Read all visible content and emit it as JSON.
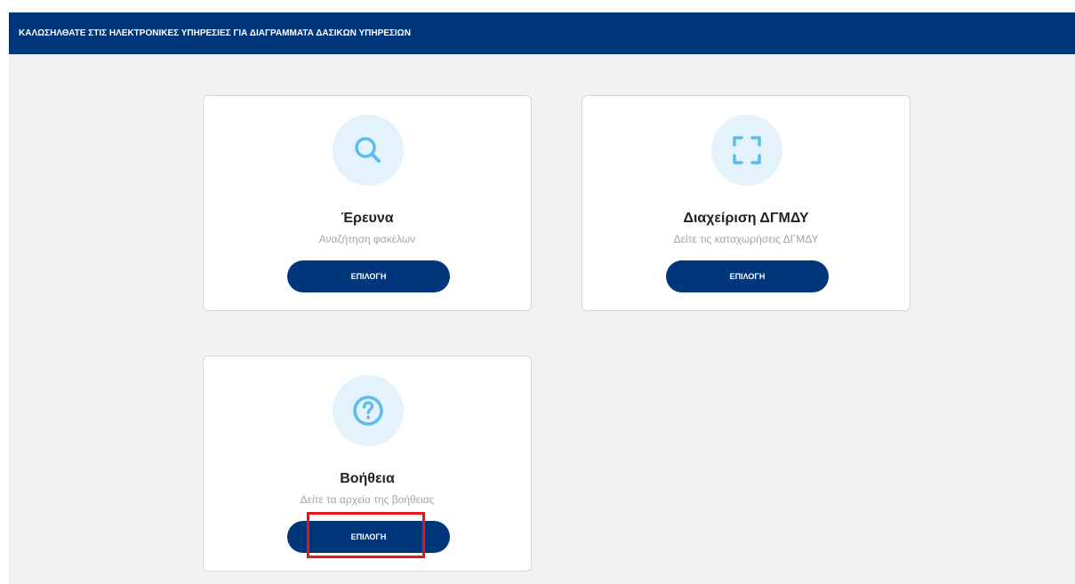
{
  "banner": {
    "title": "ΚΑΛΩΣΗΛΘΑΤΕ ΣΤΙΣ ΗΛΕΚΤΡΟΝΙΚΕΣ ΥΠΗΡΕΣΙΕΣ ΓΙΑ ΔΙΑΓΡΑΜΜΑΤΑ ΔΑΣΙΚΩΝ ΥΠΗΡΕΣΙΩΝ"
  },
  "cards": [
    {
      "icon": "search-icon",
      "title": "Έρευνα",
      "subtitle": "Αναζήτηση φακέλων",
      "button_label": "ΕΠΙΛΟΓΗ"
    },
    {
      "icon": "fullscreen-icon",
      "title": "Διαχείριση ΔΓΜΔΥ",
      "subtitle": "Δείτε τις καταχωρήσεις ΔΓΜΔΥ",
      "button_label": "ΕΠΙΛΟΓΗ"
    },
    {
      "icon": "help-icon",
      "title": "Βοήθεια",
      "subtitle": "Δείτε τα αρχεία της βοήθειας",
      "button_label": "ΕΠΙΛΟΓΗ"
    }
  ],
  "colors": {
    "primary": "#00367a",
    "icon_bg": "#e4f2fb",
    "icon": "#5bbde8",
    "highlight": "#e8141b"
  }
}
